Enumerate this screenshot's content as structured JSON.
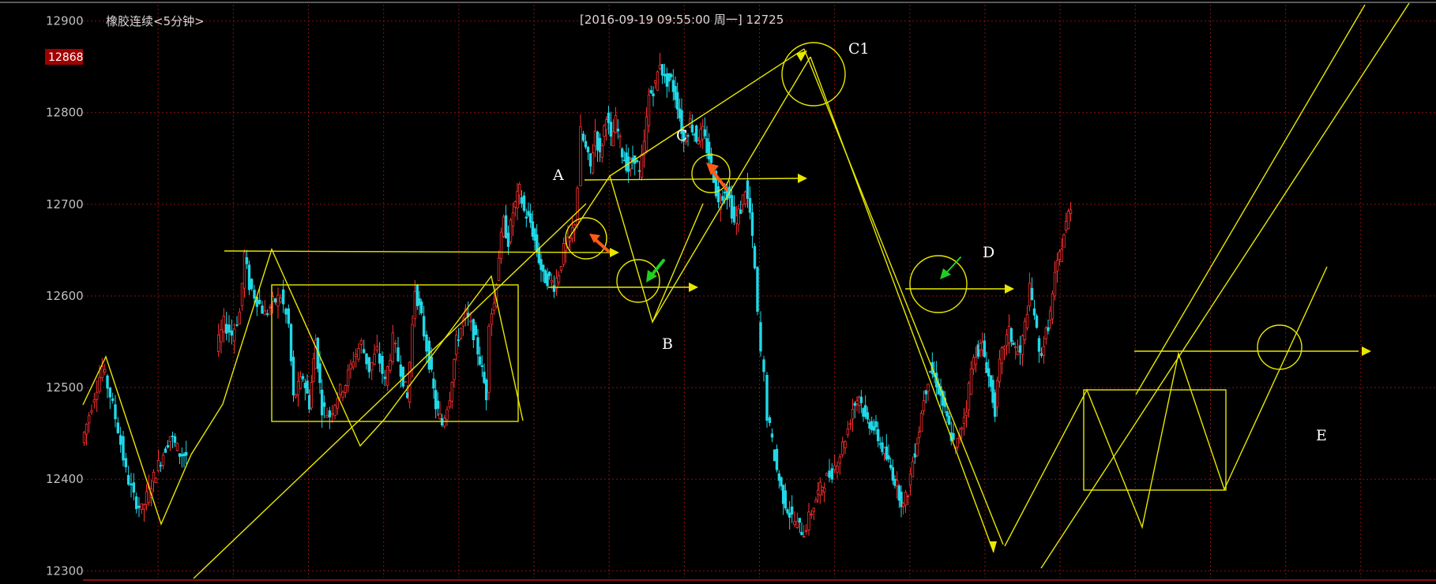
{
  "chart_data": {
    "type": "candlestick",
    "title": "橡胶连续<5分钟>",
    "info": "[2016-09-19  09:55:00 周一]    12725",
    "current_price_label": "12868",
    "y_ticks": [
      12900,
      12800,
      12700,
      12600,
      12500,
      12400,
      12300
    ],
    "ylim": [
      12296,
      12916
    ],
    "grid": true,
    "colors": {
      "background": "#000000",
      "grid": "#8b1010",
      "up_candle": "#ff3030",
      "down_candle": "#20d8e8",
      "drawings": "#ffff00",
      "arrow_red": "#ff5a1a",
      "arrow_green": "#20d020",
      "label_box": "#a00000"
    },
    "trace": [
      [
        0,
        12440
      ],
      [
        6,
        12460
      ],
      [
        16,
        12492
      ],
      [
        26,
        12522
      ],
      [
        36,
        12492
      ],
      [
        46,
        12455
      ],
      [
        56,
        12408
      ],
      [
        66,
        12380
      ],
      [
        76,
        12366
      ],
      [
        88,
        12395
      ],
      [
        100,
        12422
      ],
      [
        112,
        12448
      ],
      [
        124,
        12428
      ],
      [
        132,
        12426
      ],
      [
        170,
        12540
      ],
      [
        180,
        12570
      ],
      [
        190,
        12558
      ],
      [
        200,
        12582
      ],
      [
        206,
        12645
      ],
      [
        212,
        12612
      ],
      [
        222,
        12596
      ],
      [
        232,
        12580
      ],
      [
        242,
        12592
      ],
      [
        252,
        12600
      ],
      [
        262,
        12568
      ],
      [
        268,
        12488
      ],
      [
        274,
        12500
      ],
      [
        280,
        12512
      ],
      [
        288,
        12482
      ],
      [
        296,
        12552
      ],
      [
        304,
        12478
      ],
      [
        314,
        12470
      ],
      [
        324,
        12492
      ],
      [
        334,
        12505
      ],
      [
        344,
        12532
      ],
      [
        354,
        12548
      ],
      [
        364,
        12520
      ],
      [
        374,
        12540
      ],
      [
        384,
        12505
      ],
      [
        394,
        12552
      ],
      [
        404,
        12520
      ],
      [
        412,
        12488
      ],
      [
        422,
        12608
      ],
      [
        430,
        12575
      ],
      [
        440,
        12528
      ],
      [
        448,
        12480
      ],
      [
        456,
        12460
      ],
      [
        466,
        12492
      ],
      [
        474,
        12550
      ],
      [
        486,
        12580
      ],
      [
        496,
        12560
      ],
      [
        504,
        12530
      ],
      [
        512,
        12492
      ],
      [
        516,
        12575
      ],
      [
        522,
        12592
      ],
      [
        528,
        12645
      ],
      [
        534,
        12680
      ],
      [
        540,
        12660
      ],
      [
        546,
        12692
      ],
      [
        554,
        12715
      ],
      [
        560,
        12692
      ],
      [
        568,
        12680
      ],
      [
        576,
        12650
      ],
      [
        584,
        12620
      ],
      [
        592,
        12618
      ],
      [
        598,
        12612
      ],
      [
        604,
        12626
      ],
      [
        610,
        12650
      ],
      [
        618,
        12660
      ],
      [
        624,
        12682
      ],
      [
        628,
        12720
      ],
      [
        632,
        12778
      ],
      [
        638,
        12760
      ],
      [
        644,
        12740
      ],
      [
        650,
        12780
      ],
      [
        656,
        12752
      ],
      [
        664,
        12800
      ],
      [
        670,
        12768
      ],
      [
        676,
        12790
      ],
      [
        684,
        12756
      ],
      [
        692,
        12738
      ],
      [
        700,
        12752
      ],
      [
        706,
        12732
      ],
      [
        712,
        12765
      ],
      [
        718,
        12818
      ],
      [
        726,
        12830
      ],
      [
        732,
        12856
      ],
      [
        738,
        12835
      ],
      [
        746,
        12835
      ],
      [
        754,
        12810
      ],
      [
        762,
        12768
      ],
      [
        770,
        12790
      ],
      [
        778,
        12772
      ],
      [
        786,
        12778
      ],
      [
        794,
        12752
      ],
      [
        800,
        12730
      ],
      [
        806,
        12700
      ],
      [
        814,
        12718
      ],
      [
        820,
        12705
      ],
      [
        826,
        12680
      ],
      [
        834,
        12695
      ],
      [
        840,
        12718
      ],
      [
        846,
        12690
      ],
      [
        852,
        12628
      ],
      [
        856,
        12578
      ],
      [
        860,
        12538
      ],
      [
        864,
        12512
      ],
      [
        868,
        12470
      ],
      [
        874,
        12440
      ],
      [
        880,
        12410
      ],
      [
        888,
        12380
      ],
      [
        896,
        12362
      ],
      [
        906,
        12350
      ],
      [
        914,
        12342
      ],
      [
        924,
        12365
      ],
      [
        932,
        12385
      ],
      [
        940,
        12398
      ],
      [
        950,
        12408
      ],
      [
        960,
        12428
      ],
      [
        970,
        12455
      ],
      [
        976,
        12478
      ],
      [
        984,
        12492
      ],
      [
        992,
        12465
      ],
      [
        1000,
        12460
      ],
      [
        1008,
        12445
      ],
      [
        1016,
        12428
      ],
      [
        1024,
        12412
      ],
      [
        1032,
        12392
      ],
      [
        1040,
        12370
      ],
      [
        1046,
        12388
      ],
      [
        1052,
        12420
      ],
      [
        1060,
        12455
      ],
      [
        1066,
        12490
      ],
      [
        1074,
        12520
      ],
      [
        1082,
        12506
      ],
      [
        1090,
        12482
      ],
      [
        1098,
        12456
      ],
      [
        1106,
        12430
      ],
      [
        1114,
        12460
      ],
      [
        1120,
        12480
      ],
      [
        1126,
        12520
      ],
      [
        1132,
        12540
      ],
      [
        1140,
        12545
      ],
      [
        1148,
        12512
      ],
      [
        1156,
        12476
      ],
      [
        1162,
        12525
      ],
      [
        1168,
        12548
      ],
      [
        1174,
        12560
      ],
      [
        1182,
        12542
      ],
      [
        1188,
        12536
      ],
      [
        1194,
        12568
      ],
      [
        1200,
        12606
      ],
      [
        1206,
        12582
      ],
      [
        1212,
        12535
      ],
      [
        1218,
        12548
      ],
      [
        1226,
        12580
      ],
      [
        1232,
        12620
      ],
      [
        1238,
        12645
      ],
      [
        1246,
        12678
      ],
      [
        1252,
        12700
      ]
    ]
  },
  "annotations": {
    "A": "A",
    "B": "B",
    "C": "C",
    "C1": "C1",
    "D": "D",
    "E": "E"
  }
}
